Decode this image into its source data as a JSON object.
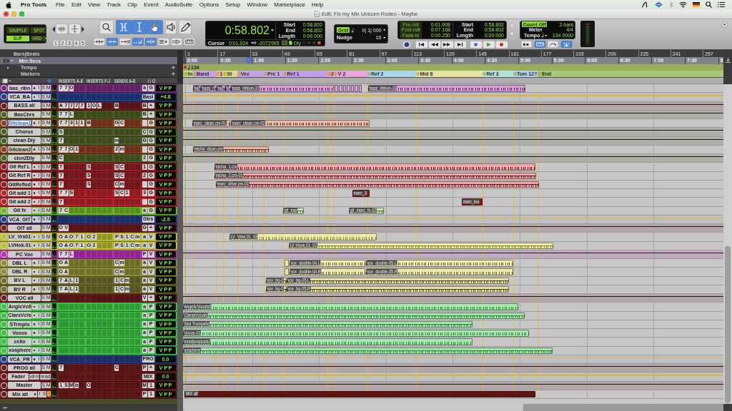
{
  "menu_bar": {
    "app": "Pro Tools",
    "items": [
      "File",
      "Edit",
      "View",
      "Track",
      "Clip",
      "Event",
      "AudioSuite",
      "Options",
      "Setup",
      "Window",
      "Marketplace",
      "Help"
    ]
  },
  "window": {
    "title": "Edit: Fix my Mix Unicorn Rodeo - Maybe"
  },
  "edit_modes": [
    {
      "label": "SHUFFLE",
      "selected": false
    },
    {
      "label": "SPOT",
      "selected": false
    },
    {
      "label": "SLIP",
      "selected": true
    },
    {
      "label": "GRID",
      "selected": false,
      "dropdown": true
    }
  ],
  "zoom_presets": [
    "1",
    "2",
    "3",
    "4",
    "5"
  ],
  "tools": [
    {
      "kind": "zoom",
      "selected": false
    },
    {
      "kind": "trim",
      "selected": true
    },
    {
      "kind": "selector",
      "selected": true
    },
    {
      "kind": "grabber",
      "selected": true
    },
    {
      "kind": "scrub",
      "selected": false
    },
    {
      "kind": "pencil",
      "selected": false
    }
  ],
  "edit_toggles": [
    {
      "kind": "spread",
      "selected": false
    },
    {
      "kind": "link",
      "selected": true
    },
    {
      "kind": "track",
      "selected": false
    },
    {
      "kind": "mirror",
      "selected": true
    },
    {
      "kind": "insert",
      "selected": true
    },
    {
      "kind": "lines",
      "selected": false
    },
    {
      "kind": "tab",
      "selected": false
    },
    {
      "kind": "keys",
      "selected": false
    }
  ],
  "counter": {
    "main": "0:58.802",
    "rows": [
      {
        "label": "Start",
        "value": "0:58.802"
      },
      {
        "label": "End",
        "value": "0:58.802"
      },
      {
        "label": "Length",
        "value": "0:00.000"
      }
    ],
    "cursor_label": "Cursor",
    "cursor": "0:01.024",
    "samples": "-2072995",
    "delay": "Dly"
  },
  "grid": {
    "label": "Grid",
    "on": true,
    "value": "0| 1| 000",
    "nudge_label": "Nudge",
    "nudge": "10"
  },
  "rolls": [
    {
      "label": "Pre-roll",
      "on": false,
      "value": "0:01.008"
    },
    {
      "label": "Post-roll",
      "on": false,
      "value": "0:07.168"
    },
    {
      "label": "Fade-in",
      "on": false,
      "value": "0:00.250"
    }
  ],
  "selection": [
    {
      "label": "Start",
      "value": "0:58.802"
    },
    {
      "label": "End",
      "value": "0:58.802"
    },
    {
      "label": "Length",
      "value": "0:00.000"
    }
  ],
  "transport": [
    {
      "kind": "online"
    },
    {
      "kind": "return"
    },
    {
      "kind": "rewind"
    },
    {
      "kind": "forward"
    },
    {
      "kind": "end"
    },
    {
      "kind": "stop"
    },
    {
      "kind": "play"
    },
    {
      "kind": "record"
    }
  ],
  "tempo": {
    "count_off": {
      "label": "Count Off",
      "on": true
    },
    "count": "2 bars",
    "meter_label": "Meter",
    "meter": "4/4",
    "tempo_label": "Tempo",
    "tempo": "134.0000"
  },
  "midi_buttons": [
    {
      "kind": "dots",
      "selected": false
    },
    {
      "kind": "keys",
      "selected": true
    },
    {
      "kind": "curve",
      "selected": false
    },
    {
      "kind": "fan",
      "selected": true
    }
  ],
  "ruler": {
    "labels": [
      "Bars|Beats",
      "Min:Secs",
      "Tempo",
      "Markers"
    ],
    "bars": [
      "1",
      "17",
      "33",
      "49",
      "65",
      "81",
      "97",
      "113",
      "129",
      "145",
      "161",
      "177",
      "193",
      "209",
      "225",
      "241",
      "257"
    ],
    "times": [
      "0:00",
      "0:30",
      "1:00",
      "1:30",
      "2:00",
      "2:30",
      "3:00",
      "3:30",
      "4:00",
      "4:30",
      "5:00",
      "5:30",
      "6:00",
      "6:30",
      "7:00",
      "7:30",
      "8"
    ],
    "tempo": "134",
    "markers": [
      {
        "label": "In",
        "color": "#b9d78e"
      },
      {
        "label": "Band",
        "color": "#c7a4e2"
      },
      {
        "label": "1",
        "color": "#e9b9a2"
      },
      {
        "label": "St",
        "color": "#d9d891"
      },
      {
        "label": "Vec",
        "color": "#c7a4e2"
      },
      {
        "label": "Pre 1",
        "color": "#c9a6e4"
      },
      {
        "label": "Ref 1",
        "color": "#c4a0ea"
      },
      {
        "label": "2",
        "color": "#e8a2d2"
      },
      {
        "label": "V 2",
        "color": "#e9a5da"
      },
      {
        "label": "Ref 2",
        "color": "#a9d5ed"
      },
      {
        "label": "Mid 8",
        "color": "#e7e3a5"
      },
      {
        "label": "Ref 3",
        "color": "#b5e1dd"
      },
      {
        "label": "Tom 12?",
        "color": "#b1d1ed"
      },
      {
        "label": "End",
        "color": "#a7c878"
      }
    ]
  },
  "track_header": [
    "INSERTS A-E",
    "INSERTS F-J",
    "SENDS A-E",
    "I / O"
  ],
  "tracks": [
    {
      "name": "bas_ribn",
      "kind": "audio",
      "color": "#7a2e7e",
      "selected": false,
      "record": true,
      "buttons": [
        "I",
        "S",
        "M"
      ],
      "inserts": [
        "7",
        "7",
        "O"
      ],
      "input": "a",
      "output": "G",
      "display": "V P P",
      "fragments": true,
      "clips": [
        {
          "name": "ba",
          "color": "#d9a2d9"
        },
        {
          "name": "bass_r",
          "color": "#d9a2d9"
        },
        {
          "name": "ba",
          "color": "#d9a2d9"
        },
        {
          "name": "b",
          "color": "#d9a2d9"
        },
        {
          "name": "bass_ribbon-37",
          "color": "#d9a2d9"
        },
        {
          "name": "bass_ribbon-33",
          "color": "#d9a2d9"
        }
      ]
    },
    {
      "name": "VCA_BA",
      "kind": "vca",
      "color": "#283a82",
      "selected": false,
      "record": true,
      "buttons": [
        "I",
        "S",
        "M"
      ],
      "output": "Basi",
      "display": "+4.8"
    },
    {
      "name": "BASS all",
      "kind": "aux",
      "color": "#6c1c1e",
      "selected": false,
      "record": false,
      "buttons": [
        "S",
        "M"
      ],
      "inserts": [
        "A",
        "7",
        "7",
        "7",
        "7"
      ],
      "inserts_2": [
        "1",
        "O",
        "L"
      ],
      "sends": [
        "B"
      ],
      "input": "B",
      "output": "+",
      "display": "V P P"
    },
    {
      "name": "BasChrs",
      "kind": "aux",
      "color": "#4f5f27",
      "selected": false,
      "record": false,
      "buttons": [
        "S",
        "M"
      ],
      "inserts": [
        "7",
        "7",
        "L"
      ],
      "input": "B",
      "output": "+",
      "display": "V P P"
    },
    {
      "name": "Gitclean1",
      "kind": "audio",
      "color": "#87411f",
      "selected": true,
      "record": true,
      "buttons": [
        "I",
        "S",
        "M"
      ],
      "inserts": [
        "7",
        "7",
        "3",
        "1",
        "1"
      ],
      "inserts_2": [
        "B"
      ],
      "sends": [
        "G",
        "C"
      ],
      "output": "G",
      "display": "V P P",
      "clips": [
        {
          "name": "marc_clean.cm-01",
          "color": "#eabcaa"
        },
        {
          "name": "marc_clean.cm-02",
          "color": "#eabcaa"
        }
      ]
    },
    {
      "name": "Chorus",
      "kind": "aux",
      "color": "#4f5f27",
      "selected": false,
      "record": false,
      "buttons": [
        "S",
        "M"
      ],
      "inserts": [
        "S"
      ],
      "input": "C",
      "output": "G",
      "display": "V P P"
    },
    {
      "name": "clean Dly",
      "kind": "aux",
      "color": "#4f5f27",
      "selected": false,
      "record": false,
      "buttons": [
        "S",
        "M"
      ],
      "inserts": [
        "7"
      ],
      "sends": [
        "m"
      ],
      "input": "G",
      "output": "G",
      "display": "V P P"
    },
    {
      "name": "Gitclean2",
      "kind": "audio",
      "color": "#87411f",
      "selected": false,
      "record": true,
      "buttons": [
        "I",
        "S",
        "M"
      ],
      "inserts": [
        "7",
        "7",
        "O",
        "1"
      ],
      "sends": [
        "2",
        "m"
      ],
      "output": "G",
      "display": "V P P",
      "clips": [
        {
          "name": "micha_clean.cm",
          "color": "#eabcaa"
        }
      ]
    },
    {
      "name": "clen2Dly",
      "kind": "aux",
      "color": "#4f5f27",
      "selected": false,
      "record": false,
      "buttons": [
        "S",
        "M"
      ],
      "inserts": [
        "C"
      ],
      "input": "2",
      "output": "G",
      "display": "V P P"
    },
    {
      "name": "Git Ref L",
      "kind": "audio",
      "color": "#8e1f24",
      "selected": false,
      "record": true,
      "buttons": [
        "I",
        "S",
        "M"
      ],
      "inserts": [
        "7"
      ],
      "inserts_2": [
        "S"
      ],
      "sends": [
        "S",
        "C"
      ],
      "input": "1",
      "output": "G",
      "display": "V P P",
      "clips": [
        {
          "name": "micha_1.cm",
          "color": "#eca9aa"
        }
      ]
    },
    {
      "name": "Git Ref R",
      "kind": "audio",
      "color": "#8e1f24",
      "selected": false,
      "record": true,
      "buttons": [
        "I",
        "S",
        "M"
      ],
      "inserts": [
        "7"
      ],
      "inserts_2": [
        "S"
      ],
      "sends": [
        "S",
        "C"
      ],
      "input": "2",
      "output": "G",
      "display": "V P P",
      "clips": [
        {
          "name": "micha_2.cm-01",
          "color": "#eca9aa"
        }
      ]
    },
    {
      "name": "GitRefled",
      "kind": "audio",
      "color": "#8e1f24",
      "selected": false,
      "record": true,
      "buttons": [
        "I",
        "S",
        "M"
      ],
      "inserts": [
        "7"
      ],
      "inserts_2": [
        "S"
      ],
      "sends": [
        "C",
        "m"
      ],
      "output": "G",
      "display": "V P P",
      "clips": [
        {
          "name": "marc_drive.cm-01",
          "color": "#eca9aa"
        }
      ]
    },
    {
      "name": "Git add 1",
      "kind": "audio",
      "color": "#b42428",
      "selected": false,
      "record": true,
      "buttons": [
        "I",
        "S",
        "M"
      ],
      "inserts": [
        "7",
        "7",
        "S"
      ],
      "sends": [
        "S",
        "C",
        "1"
      ],
      "input": "3",
      "output": "G",
      "display": "V P P",
      "clips": [
        {
          "name": "marc_3",
          "color": "#8e1a1c"
        }
      ]
    },
    {
      "name": "Git add 2",
      "kind": "audio",
      "color": "#b42428",
      "selected": false,
      "record": true,
      "buttons": [
        "I",
        "S",
        "M"
      ],
      "inserts": [
        "7"
      ],
      "output": "G",
      "display": "V P P",
      "clips": [
        {
          "name": "marc_lea",
          "color": "#8e1a1c"
        }
      ]
    },
    {
      "name": "Git fx",
      "kind": "audio",
      "color": "#6cb624",
      "selected": false,
      "record": true,
      "buttons": [
        "I",
        "S",
        "M"
      ],
      "inserts": [
        "7",
        "C"
      ],
      "input": "a",
      "output": "G",
      "display": "V P P",
      "clips": [
        {
          "name": "git_mar",
          "color": "#d3dfc3"
        },
        {
          "name": "git_marc_fx-02",
          "color": "#d3dfc3"
        }
      ]
    },
    {
      "name": "VCA_GIT",
      "kind": "vca",
      "color": "#283a82",
      "selected": false,
      "record": true,
      "buttons": [
        "I",
        "S",
        "M"
      ],
      "output": "Gtrs",
      "display": "-2.5"
    },
    {
      "name": "GIT all",
      "kind": "aux",
      "color": "#6c1c1e",
      "selected": false,
      "record": false,
      "buttons": [
        "S",
        "M"
      ],
      "inserts": [
        "O",
        "V"
      ],
      "input": "G",
      "output": "+",
      "display": "V P P"
    },
    {
      "name": "LV_Vrs01",
      "kind": "audio",
      "color": "#bcbc34",
      "selected": false,
      "record": true,
      "buttons": [
        "I",
        "S",
        "M"
      ],
      "inserts": [
        "O",
        "A",
        "O",
        "7",
        "1"
      ],
      "inserts_2": [
        "O",
        "2"
      ],
      "sends": [
        "P",
        "S",
        "1",
        "C",
        "m"
      ],
      "input": "a",
      "output": "V",
      "display": "V P P",
      "clips": [
        {
          "name": "LV_Vrse.01_03",
          "color": "#efecb2"
        }
      ]
    },
    {
      "name": "LVHok.01",
      "kind": "audio",
      "color": "#bcbc34",
      "selected": false,
      "record": true,
      "buttons": [
        "I",
        "S",
        "M"
      ],
      "inserts": [
        "O",
        "A",
        "O",
        "7",
        "1"
      ],
      "inserts_2": [
        "O",
        "2"
      ],
      "sends": [
        "P",
        "S",
        "1",
        "C",
        "m"
      ],
      "input": "a",
      "output": "V",
      "display": "V P P",
      "clips": [
        {
          "name": "LV Hook.01_02",
          "color": "#efecb2"
        }
      ]
    },
    {
      "name": "PC Voc",
      "kind": "aux",
      "color": "#b531b3",
      "selected": false,
      "record": false,
      "buttons": [
        "S",
        "M"
      ],
      "inserts": [
        "7",
        "7",
        "L"
      ],
      "input": "P",
      "output": "V",
      "display": "V P P"
    },
    {
      "name": "DBL L",
      "kind": "audio",
      "color": "#8d8b35",
      "selected": false,
      "record": true,
      "buttons": [
        "I",
        "S",
        "M"
      ],
      "inserts": [
        "O",
        "A"
      ],
      "sends": [
        "C",
        "m"
      ],
      "input": "a",
      "output": "V",
      "display": "V P P",
      "fragments": true,
      "clips": [
        {
          "name": "vox_double-04.L",
          "color": "#eee8b2"
        },
        {
          "name": "vox_double-05.L",
          "color": "#eee8b2"
        }
      ]
    },
    {
      "name": "DBL R",
      "kind": "audio",
      "color": "#8d8b35",
      "selected": false,
      "record": true,
      "buttons": [
        "I",
        "S",
        "M"
      ],
      "inserts": [
        "O",
        "A"
      ],
      "sends": [
        "C",
        "m"
      ],
      "input": "a",
      "output": "V",
      "display": "V P P",
      "fragments": true,
      "clips": [
        {
          "name": "vox_double-04.R",
          "color": "#eee8b2"
        },
        {
          "name": "vox_double-05.R",
          "color": "#eee8b2"
        }
      ]
    },
    {
      "name": "BV L",
      "kind": "audio",
      "color": "#6e6c2b",
      "selected": false,
      "record": true,
      "buttons": [
        "I",
        "S",
        "M"
      ],
      "inserts": [
        "7",
        "A",
        "L",
        "1"
      ],
      "sends": [
        "1",
        "C",
        "m"
      ],
      "input": "a",
      "output": "V",
      "display": "V P P",
      "clips": [
        {
          "name": "vox_bg-0",
          "color": "#e9e1aa"
        },
        {
          "name": "vox_bg-05.L",
          "color": "#e9e1aa"
        }
      ]
    },
    {
      "name": "BV R",
      "kind": "audio",
      "color": "#6e6c2b",
      "selected": false,
      "record": true,
      "buttons": [
        "I",
        "S",
        "M"
      ],
      "inserts": [
        "7",
        "A",
        "L",
        "1"
      ],
      "sends": [
        "1",
        "C",
        "m"
      ],
      "input": "a",
      "output": "V",
      "display": "V P P",
      "clips": [
        {
          "name": "vox_bg-0",
          "color": "#e9e1aa"
        },
        {
          "name": "vox_bg-05.R",
          "color": "#e9e1aa"
        }
      ]
    },
    {
      "name": "VOC all",
      "kind": "aux",
      "color": "#6c1c1e",
      "selected": false,
      "record": false,
      "buttons": [
        "S",
        "M"
      ],
      "input": "V",
      "output": "+",
      "display": "V P P"
    },
    {
      "name": "AnglcVc6",
      "kind": "audio",
      "color": "#3fc044",
      "selected": false,
      "record": true,
      "buttons": [
        "I",
        "S",
        "M"
      ],
      "input": "a",
      "output": "P",
      "display": "V P P",
      "clips": [
        {
          "name": "AngelicVocals6",
          "color": "#a7e6b1"
        }
      ]
    },
    {
      "name": "ClarsVcls",
      "kind": "audio",
      "color": "#3fc044",
      "selected": false,
      "record": true,
      "buttons": [
        "I",
        "S",
        "M"
      ],
      "input": "a",
      "output": "P",
      "display": "V P P",
      "clips": [
        {
          "name": "ClarasVocals",
          "color": "#a7e6b1"
        }
      ]
    },
    {
      "name": "STrmpts",
      "kind": "audio",
      "color": "#3fc044",
      "selected": false,
      "record": true,
      "buttons": [
        "I",
        "S",
        "M"
      ],
      "input": "a",
      "output": "P",
      "display": "V P P",
      "clips": [
        {
          "name": "Sea Trumpets",
          "color": "#a7e6b1"
        }
      ]
    },
    {
      "name": "Voxos",
      "kind": "audio",
      "color": "#3fc044",
      "selected": false,
      "record": true,
      "buttons": [
        "I",
        "S",
        "M"
      ],
      "input": "a",
      "output": "P",
      "display": "V P P",
      "clips": [
        {
          "name": "Voxos-01",
          "color": "#a7e6b1"
        }
      ]
    },
    {
      "name": "cello",
      "kind": "audio",
      "color": "#3fc044",
      "selected": false,
      "record": true,
      "buttons": [
        "I",
        "S",
        "M"
      ],
      "input": "a",
      "output": "P",
      "display": "V P P",
      "clips": [
        {
          "name": "emotionalcello",
          "color": "#a7e6b1"
        }
      ]
    },
    {
      "name": "xosphere",
      "kind": "audio",
      "color": "#3fc044",
      "selected": false,
      "record": true,
      "buttons": [
        "I",
        "S",
        "M"
      ],
      "input": "a",
      "output": "P",
      "display": "V P P",
      "clips": [
        {
          "name": "xosphere",
          "color": "#a7e6b1"
        }
      ]
    },
    {
      "name": "VCA_PR",
      "kind": "vca",
      "color": "#283a82",
      "selected": false,
      "record": true,
      "buttons": [
        "I",
        "S",
        "M"
      ],
      "output": "PRO",
      "display": "0.0"
    },
    {
      "name": "PROG all",
      "kind": "aux",
      "color": "#6c1c1e",
      "selected": false,
      "record": false,
      "buttons": [
        "S",
        "M"
      ],
      "inserts": [
        "7"
      ],
      "sends": [
        "C"
      ],
      "input": "P",
      "output": "+",
      "display": "V P P"
    },
    {
      "name": "Fader",
      "kind": "vca",
      "color": "#6c1c1e",
      "selected": false,
      "record": false,
      "buttons": [
        "vtrm",
        "read"
      ],
      "output": "MIX",
      "display": "0.0"
    },
    {
      "name": "Master",
      "kind": "master",
      "color": "#6c1c1e",
      "selected": false,
      "record": false,
      "buttons": [
        "S",
        "M"
      ],
      "inserts": [
        "1",
        "S",
        "M",
        "b"
      ],
      "inserts_2": [
        "O"
      ],
      "input": "M",
      "output": "1",
      "display": "V P P"
    },
    {
      "name": "Mix alt",
      "kind": "audio",
      "color": "#6c1c1e",
      "selected": false,
      "record": true,
      "buttons": [
        "I",
        "S"
      ],
      "alert": true,
      "input": "P",
      "output": "1",
      "display": "V P P",
      "clips": [
        {
          "name": "MIX alt",
          "color": "#6b1414"
        }
      ]
    }
  ]
}
